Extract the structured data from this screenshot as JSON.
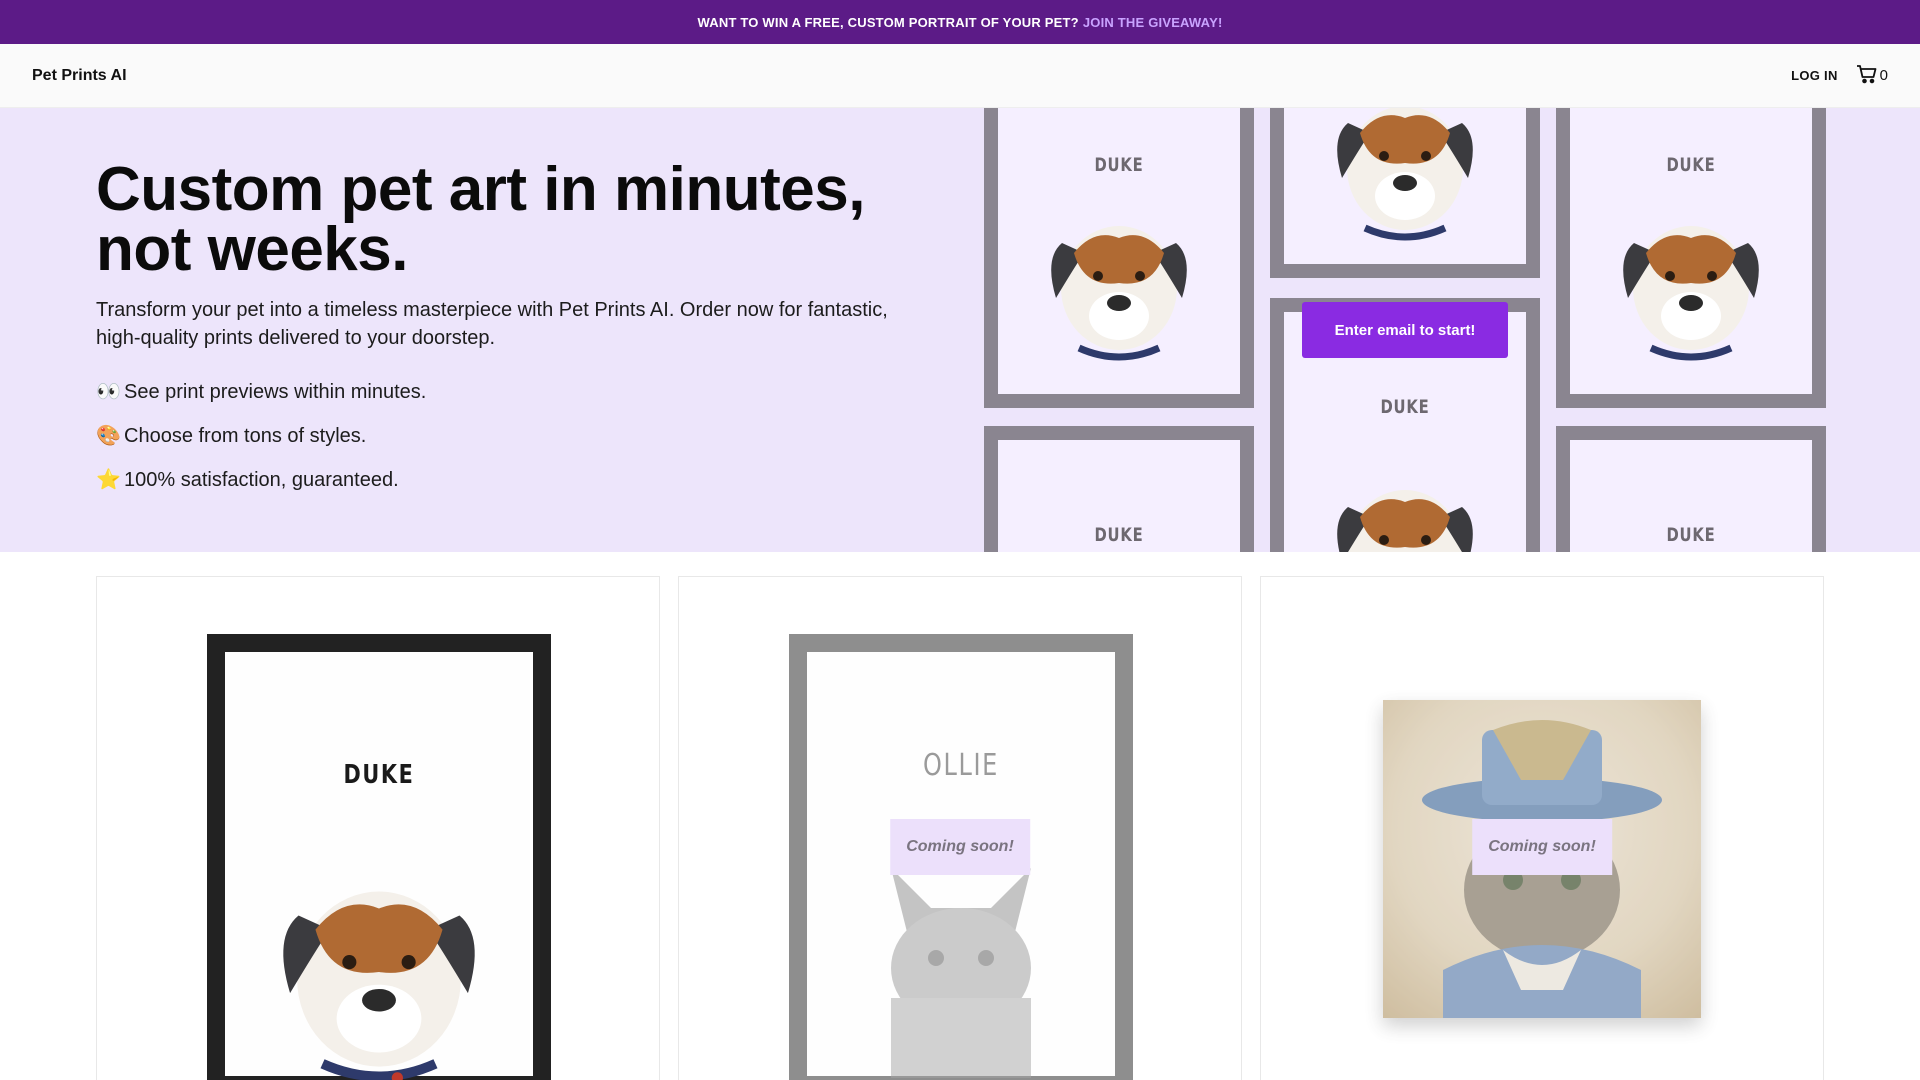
{
  "announcement": {
    "text": "WANT TO WIN A FREE, CUSTOM PORTRAIT OF YOUR PET?",
    "link": "JOIN THE GIVEAWAY!"
  },
  "header": {
    "brand": "Pet Prints AI",
    "login": "LOG IN",
    "cart_count": "0"
  },
  "hero": {
    "title_line1": "Custom pet art in minutes,",
    "title_line2": "not weeks.",
    "subtitle": "Transform your pet into a timeless masterpiece with Pet Prints AI. Order now for fantastic, high-quality prints delivered to your doorstep.",
    "features": [
      {
        "emoji": "👀",
        "text": "See print previews within minutes."
      },
      {
        "emoji": "🎨",
        "text": "Choose from tons of styles."
      },
      {
        "emoji": "⭐",
        "text": "100% satisfaction, guaranteed."
      }
    ],
    "cta": "Enter email to start!",
    "collage_name": "DUKE"
  },
  "products": [
    {
      "name": "DUKE",
      "badge": ""
    },
    {
      "name": "OLLIE",
      "badge": "Coming soon!"
    },
    {
      "name": "",
      "badge": "Coming soon!"
    }
  ],
  "colors": {
    "announcement_bg": "#5c1b87",
    "announcement_link": "#c9a3ff",
    "hero_bg": "#ede5fb",
    "cta_bg": "#8a2be2",
    "frame_gray": "#8a8590"
  }
}
